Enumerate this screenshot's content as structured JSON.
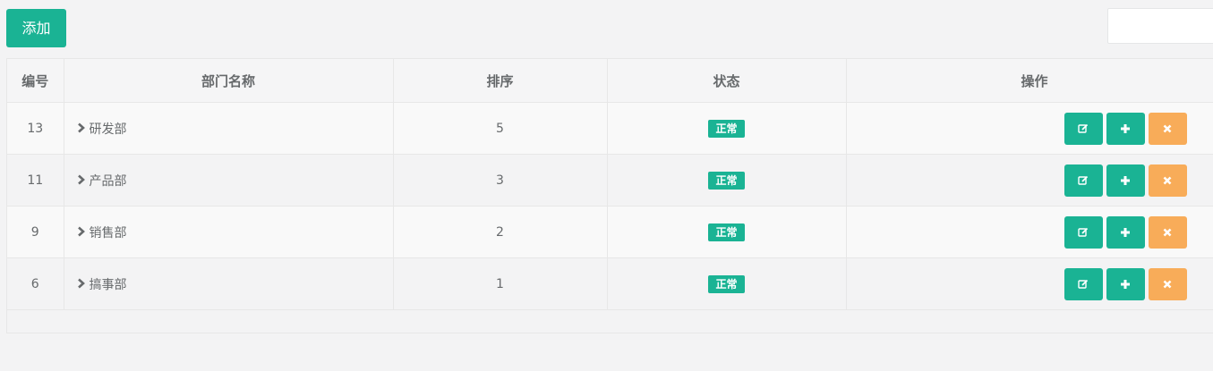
{
  "toolbar": {
    "add_label": "添加",
    "search_value": "",
    "search_placeholder": ""
  },
  "table": {
    "headers": [
      "编号",
      "部门名称",
      "排序",
      "状态",
      "操作"
    ],
    "rows": [
      {
        "id": "13",
        "name": "研发部",
        "order": "5",
        "status": "正常"
      },
      {
        "id": "11",
        "name": "产品部",
        "order": "3",
        "status": "正常"
      },
      {
        "id": "9",
        "name": "销售部",
        "order": "2",
        "status": "正常"
      },
      {
        "id": "6",
        "name": "搞事部",
        "order": "1",
        "status": "正常"
      }
    ]
  },
  "icons": {
    "edit": "edit-icon",
    "add": "plus-icon",
    "delete": "close-icon",
    "expand": "chevron-right-icon"
  },
  "colors": {
    "primary": "#1ab394",
    "warning": "#f8ac59"
  }
}
